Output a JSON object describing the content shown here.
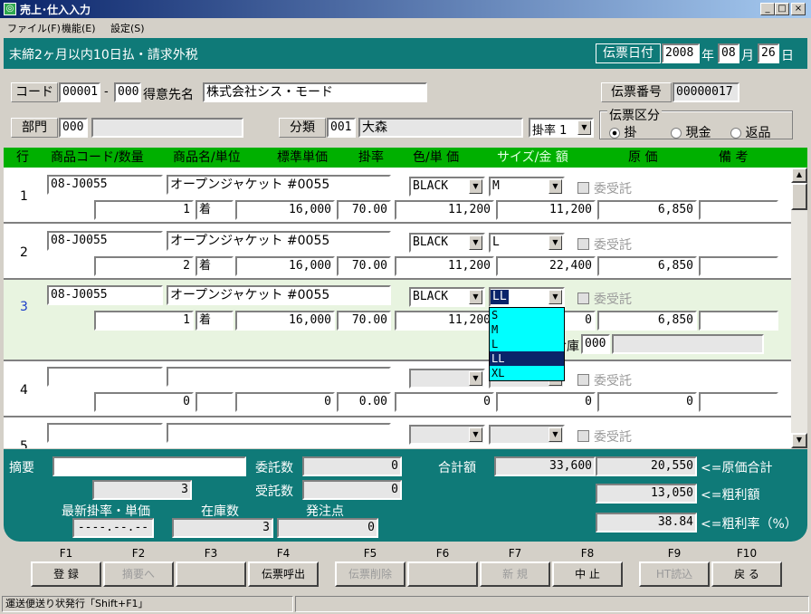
{
  "window": {
    "title": "売上･仕入入力",
    "menus": [
      "ファイル(F)",
      "機能(E)",
      "設定(S)"
    ]
  },
  "header": {
    "terms": "末締2ヶ月以内10日払・請求外税",
    "date_label": "伝票日付",
    "year": "2008",
    "year_unit": "年",
    "month": "08",
    "month_unit": "月",
    "day": "26",
    "day_unit": "日"
  },
  "customer": {
    "code_label": "コード",
    "code": "00001",
    "dash": "-",
    "branch": "000",
    "name_label": "得意先名",
    "name": "株式会社シス・モード",
    "slip_no_label": "伝票番号",
    "slip_no": "00000017"
  },
  "dept": {
    "label": "部門",
    "code": "000",
    "name": "",
    "class_label": "分類",
    "class_code": "001",
    "class_name": "大森",
    "rate_combo": "掛率 1",
    "slip_type_label": "伝票区分",
    "slip_types": [
      "掛",
      "現金",
      "返品"
    ]
  },
  "columns": [
    "行",
    "商品コード/数量",
    "商品名/単位",
    "標準単価",
    "掛率",
    "色/単 価",
    "サイズ/金 額",
    "原 価",
    "備 考"
  ],
  "rows": [
    {
      "no": "1",
      "code": "08-J0055",
      "name": "オープンジャケット  #0055",
      "color": "BLACK",
      "size": "M",
      "consign": "委受託",
      "qty": "1",
      "unit": "着",
      "std_price": "16,000",
      "rate": "70.00",
      "price": "11,200",
      "amount": "11,200",
      "cost": "6,850",
      "note": ""
    },
    {
      "no": "2",
      "code": "08-J0055",
      "name": "オープンジャケット  #0055",
      "color": "BLACK",
      "size": "L",
      "consign": "委受託",
      "qty": "2",
      "unit": "着",
      "std_price": "16,000",
      "rate": "70.00",
      "price": "11,200",
      "amount": "22,400",
      "cost": "6,850",
      "note": ""
    },
    {
      "no": "3",
      "code": "08-J0055",
      "name": "オープンジャケット  #0055",
      "color": "BLACK",
      "size": "LL",
      "consign": "委受託",
      "qty": "1",
      "unit": "着",
      "std_price": "16,000",
      "rate": "70.00",
      "price": "11,200",
      "amount": "0",
      "cost": "6,850",
      "note": "",
      "warehouse_label": "倉庫",
      "warehouse_code": "000"
    },
    {
      "no": "4",
      "code": "",
      "name": "",
      "color": "",
      "size": "",
      "consign": "委受託",
      "qty": "0",
      "unit": "",
      "std_price": "0",
      "rate": "0.00",
      "price": "0",
      "amount": "0",
      "cost": "0",
      "note": ""
    },
    {
      "no": "5",
      "code": "",
      "name": "",
      "color": "",
      "size": "",
      "consign": "委受託"
    }
  ],
  "size_dropdown": {
    "options": [
      "S",
      "M",
      "L",
      "LL",
      "XL"
    ],
    "selected": "LL"
  },
  "summary": {
    "memo_label": "摘要",
    "memo": "",
    "count": "3",
    "consign_label": "委託数",
    "consign": "0",
    "received_label": "受託数",
    "received": "0",
    "total_label": "合計額",
    "total": "33,600",
    "cost_total": "20,550",
    "cost_total_label": "<=原価合計",
    "gross_profit": "13,050",
    "gross_profit_label": "<=粗利額",
    "gross_rate": "38.84",
    "gross_rate_label": "<=粗利率（%）",
    "latest_label": "最新掛率・単価",
    "latest": "----.--.--",
    "stock_label": "在庫数",
    "stock": "3",
    "order_label": "発注点",
    "order_point": "0"
  },
  "fkeys": [
    {
      "key": "F1",
      "label": "登 録",
      "enabled": true
    },
    {
      "key": "F2",
      "label": "摘要へ",
      "enabled": false
    },
    {
      "key": "F3",
      "label": "",
      "enabled": true
    },
    {
      "key": "F4",
      "label": "伝票呼出",
      "enabled": true
    },
    {
      "key": "F5",
      "label": "伝票削除",
      "enabled": false
    },
    {
      "key": "F6",
      "label": "",
      "enabled": true
    },
    {
      "key": "F7",
      "label": "新 規",
      "enabled": false
    },
    {
      "key": "F8",
      "label": "中 止",
      "enabled": true
    },
    {
      "key": "F9",
      "label": "HT読込",
      "enabled": false
    },
    {
      "key": "F10",
      "label": "戻 る",
      "enabled": true
    }
  ],
  "status": {
    "text": "運送便送り状発行「Shift+F1」"
  },
  "colors": {
    "teal": "#0f7a78",
    "green": "#00b000",
    "title": "#0a246a",
    "dropdown": "#00ffff",
    "highlight": "#0a246a"
  }
}
